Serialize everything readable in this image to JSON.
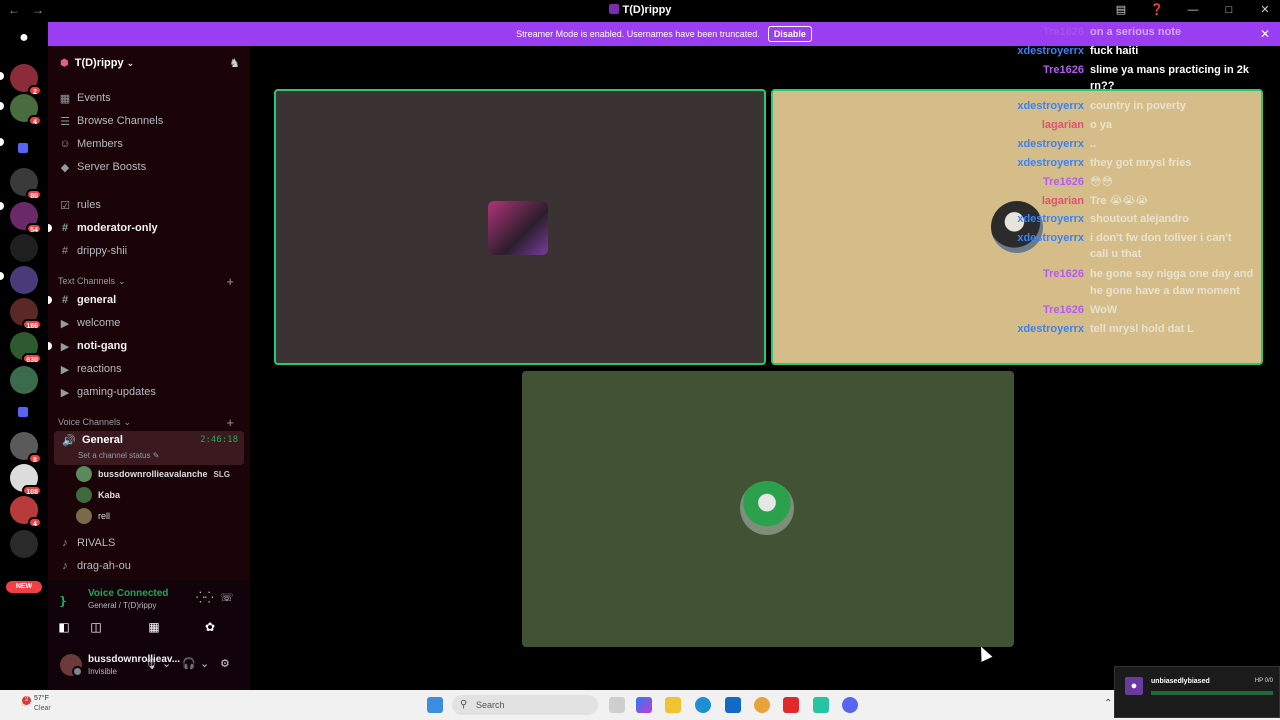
{
  "window": {
    "title": "T(D)rippy"
  },
  "banner": {
    "text": "Streamer Mode is enabled. Usernames have been truncated.",
    "button": "Disable"
  },
  "rail": {
    "badges": [
      "2",
      "4",
      "80",
      "54",
      "186",
      "630",
      "8",
      "108",
      "4"
    ],
    "new_label": "NEW"
  },
  "server": {
    "name": "T(D)rippy",
    "nav": [
      {
        "label": "Events",
        "icon": "calendar-icon"
      },
      {
        "label": "Browse Channels",
        "icon": "browse-icon"
      },
      {
        "label": "Members",
        "icon": "members-icon"
      },
      {
        "label": "Server Boosts",
        "icon": "boost-icon"
      }
    ],
    "channels_top": [
      {
        "label": "rules",
        "icon": "rules-icon",
        "bold": false
      },
      {
        "label": "moderator-only",
        "icon": "hash-icon",
        "bold": true
      },
      {
        "label": "drippy-shii",
        "icon": "hash-icon",
        "bold": false
      }
    ],
    "text_category": "Text Channels",
    "text_channels": [
      {
        "label": "general",
        "icon": "hash-icon",
        "bold": true
      },
      {
        "label": "welcome",
        "icon": "megaphone-icon",
        "bold": false
      },
      {
        "label": "noti-gang",
        "icon": "megaphone-icon",
        "bold": true
      },
      {
        "label": "reactions",
        "icon": "megaphone-icon",
        "bold": false
      },
      {
        "label": "gaming-updates",
        "icon": "megaphone-icon",
        "bold": false
      }
    ],
    "voice_category": "Voice Channels",
    "voice_channel": {
      "name": "General",
      "time": "2:46:18",
      "status": "Set a channel status"
    },
    "voice_users": [
      {
        "name": "bussdownrollieavalanche",
        "tag": "SLG"
      },
      {
        "name": "Kaba",
        "tag": ""
      },
      {
        "name": "rell",
        "tag": ""
      }
    ],
    "other_voice": [
      {
        "label": "RIVALS",
        "icon": "speaker-icon"
      },
      {
        "label": "drag-ah-ou",
        "icon": "speaker-icon"
      }
    ]
  },
  "voice_panel": {
    "title": "Voice Connected",
    "subtitle": "General / T(D)rippy",
    "user_name": "bussdownrollieav...",
    "user_state": "Invisible"
  },
  "chat": [
    {
      "user": "Tre1626",
      "msg": "on a serious note",
      "ucolor": "#b45cf0",
      "mcolor": "#ffffff",
      "faded": true
    },
    {
      "user": "xdestroyerrx",
      "msg": "fuck haiti",
      "ucolor": "#3b82f6",
      "mcolor": "#ffffff",
      "faded": false
    },
    {
      "user": "Tre1626",
      "msg": "slime ya mans practicing in 2k",
      "ucolor": "#b45cf0",
      "mcolor": "#ffffff",
      "faded": false
    },
    {
      "user": "",
      "msg": "rn??",
      "ucolor": "#b45cf0",
      "mcolor": "#ffffff",
      "faded": false
    },
    {
      "user": "xdestroyerrx",
      "msg": "country in poverty",
      "ucolor": "#3b82f6",
      "mcolor": "#e8e2cf",
      "faded": false
    },
    {
      "user": "lagarian",
      "msg": "o ya",
      "ucolor": "#e3516f",
      "mcolor": "#e8e2cf",
      "faded": false
    },
    {
      "user": "xdestroyerrx",
      "msg": "..",
      "ucolor": "#3b82f6",
      "mcolor": "#e8e2cf",
      "faded": false
    },
    {
      "user": "xdestroyerrx",
      "msg": "they got mrysl fries",
      "ucolor": "#3b82f6",
      "mcolor": "#e8e2cf",
      "faded": false
    },
    {
      "user": "Tre1626",
      "msg": "😳😳",
      "ucolor": "#b45cf0",
      "mcolor": "#e8e2cf",
      "faded": false
    },
    {
      "user": "lagarian",
      "msg": "Tre 😭😭😭",
      "ucolor": "#e3516f",
      "mcolor": "#e8e2cf",
      "faded": false
    },
    {
      "user": "xdestroyerrx",
      "msg": "shoutout alejandro",
      "ucolor": "#3b82f6",
      "mcolor": "#e8e2cf",
      "faded": false
    },
    {
      "user": "xdestroyerrx",
      "msg": "i don't fw don toliver i can't",
      "ucolor": "#3b82f6",
      "mcolor": "#e8e2cf",
      "faded": false
    },
    {
      "user": "",
      "msg": "call u that",
      "ucolor": "#3b82f6",
      "mcolor": "#e8e2cf",
      "faded": false
    },
    {
      "user": "Tre1626",
      "msg": "he gone say nigga one day and",
      "ucolor": "#b45cf0",
      "mcolor": "#e8e2cf",
      "faded": false
    },
    {
      "user": "",
      "msg": "he gone have a daw moment",
      "ucolor": "#b45cf0",
      "mcolor": "#e8e2cf",
      "faded": false
    },
    {
      "user": "Tre1626",
      "msg": "WoW",
      "ucolor": "#b45cf0",
      "mcolor": "#e8e2cf",
      "faded": false
    },
    {
      "user": "xdestroyerrx",
      "msg": "tell mrysl hold dat L",
      "ucolor": "#3b82f6",
      "mcolor": "#e8e2cf",
      "faded": false
    }
  ],
  "taskbar": {
    "weather_temp": "57°F",
    "weather_cond": "Clear",
    "weather_badge": "2",
    "search_placeholder": "Search"
  },
  "popup": {
    "name": "unbiasedlybiased",
    "hp": "HP 0/0"
  },
  "colors": {
    "banner": "#9b3df0",
    "speaking": "#2dc770",
    "sidebar": "#1a0407"
  }
}
